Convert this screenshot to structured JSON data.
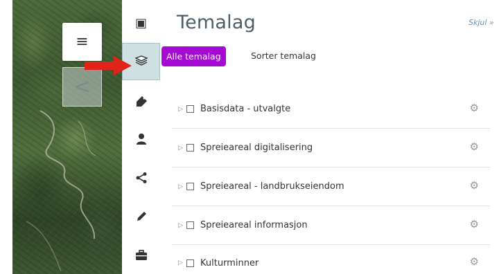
{
  "menu": {
    "icon": "hamburger-icon",
    "glyph": "≡"
  },
  "collapse": {
    "icon": "chevron-left-icon",
    "glyph": "<"
  },
  "rail": {
    "items": [
      {
        "name": "info",
        "icon": "info-icon",
        "glyph": "▣"
      },
      {
        "name": "layers",
        "icon": "layers-icon",
        "glyph": "▱"
      },
      {
        "name": "tag",
        "icon": "tag-icon",
        "glyph": "◣"
      },
      {
        "name": "user",
        "icon": "user-icon",
        "glyph": "♟"
      },
      {
        "name": "share",
        "icon": "share-icon",
        "glyph": "<"
      },
      {
        "name": "draw",
        "icon": "pencil-icon",
        "glyph": "/"
      },
      {
        "name": "tools",
        "icon": "briefcase-icon",
        "glyph": "▬"
      }
    ]
  },
  "panel": {
    "title": "Temalag",
    "hide_label": "Skjul",
    "tabs": [
      {
        "label": "Alle temalag",
        "active": true
      },
      {
        "label": "Sorter temalag",
        "active": false
      }
    ],
    "layers": [
      {
        "label": "Basisdata - utvalgte"
      },
      {
        "label": "Spreieareal digitalisering"
      },
      {
        "label": "Spreieareal - landbrukseiendom"
      },
      {
        "label": "Spreieareal informasjon"
      },
      {
        "label": "Kulturminner"
      }
    ],
    "expander_glyph": "▷",
    "gear_glyph": "⚙"
  },
  "colors": {
    "accent_purple": "#a40ad2",
    "active_rail_bg": "#cfe0e2",
    "annotation_arrow": "#e2231a",
    "link_blue": "#6b8fb0"
  }
}
